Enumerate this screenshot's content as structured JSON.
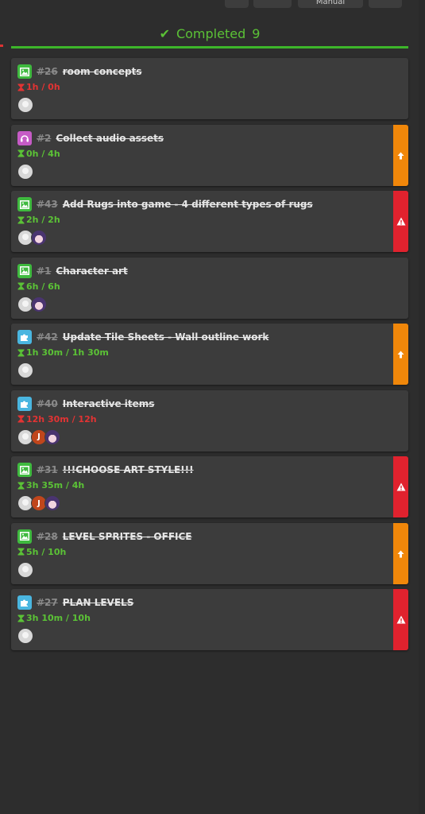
{
  "column": {
    "check_glyph": "✔",
    "label": "Completed",
    "count": "9",
    "accent_color": "#3db52a"
  },
  "toolbar": {
    "filter_label": "",
    "sort_label": "",
    "manual_label": "Manual",
    "settings_label": ""
  },
  "cards": [
    {
      "number": "#26",
      "title": "room concepts",
      "time": "1h / 0h",
      "time_status": "over",
      "type": "image",
      "flag": "none",
      "avatars": [
        "blank"
      ]
    },
    {
      "number": "#2",
      "title": "Collect audio assets",
      "time": "0h / 4h",
      "time_status": "ok",
      "type": "audio",
      "flag": "orange-up",
      "avatars": [
        "blank"
      ]
    },
    {
      "number": "#43",
      "title": "Add Rugs into game - 4 different types of rugs",
      "time": "2h / 2h",
      "time_status": "ok",
      "type": "image",
      "flag": "red-warning",
      "avatars": [
        "blank",
        "anime"
      ]
    },
    {
      "number": "#1",
      "title": "Character art",
      "time": "6h / 6h",
      "time_status": "ok",
      "type": "image",
      "flag": "none",
      "avatars": [
        "blank",
        "anime"
      ]
    },
    {
      "number": "#42",
      "title": "Update Tile Sheets - Wall outline work",
      "time": "1h 30m / 1h 30m",
      "time_status": "ok",
      "type": "puzzle",
      "flag": "orange-up",
      "avatars": [
        "blank"
      ]
    },
    {
      "number": "#40",
      "title": "Interactive items",
      "time": "12h 30m / 12h",
      "time_status": "over",
      "type": "puzzle",
      "flag": "none",
      "avatars": [
        "blank",
        "j",
        "anime"
      ]
    },
    {
      "number": "#31",
      "title": "!!!CHOOSE ART STYLE!!!",
      "time": "3h 35m / 4h",
      "time_status": "ok",
      "type": "image",
      "flag": "red-warning",
      "avatars": [
        "blank",
        "j",
        "anime"
      ]
    },
    {
      "number": "#28",
      "title": "LEVEL SPRITES - OFFICE",
      "time": "5h / 10h",
      "time_status": "ok",
      "type": "image",
      "flag": "orange-up",
      "avatars": [
        "blank"
      ]
    },
    {
      "number": "#27",
      "title": "PLAN LEVELS",
      "time": "3h 10m / 10h",
      "time_status": "ok",
      "type": "puzzle",
      "flag": "red-warning",
      "avatars": [
        "blank"
      ]
    }
  ],
  "avatar_labels": {
    "j": "J"
  },
  "colors": {
    "image_type": "#3fba3f",
    "audio_type": "#c65bc6",
    "puzzle_type": "#4ab6e0",
    "time_ok": "#5bc236",
    "time_over": "#e23333",
    "flag_orange": "#f0870a",
    "flag_red": "#e0222e"
  }
}
